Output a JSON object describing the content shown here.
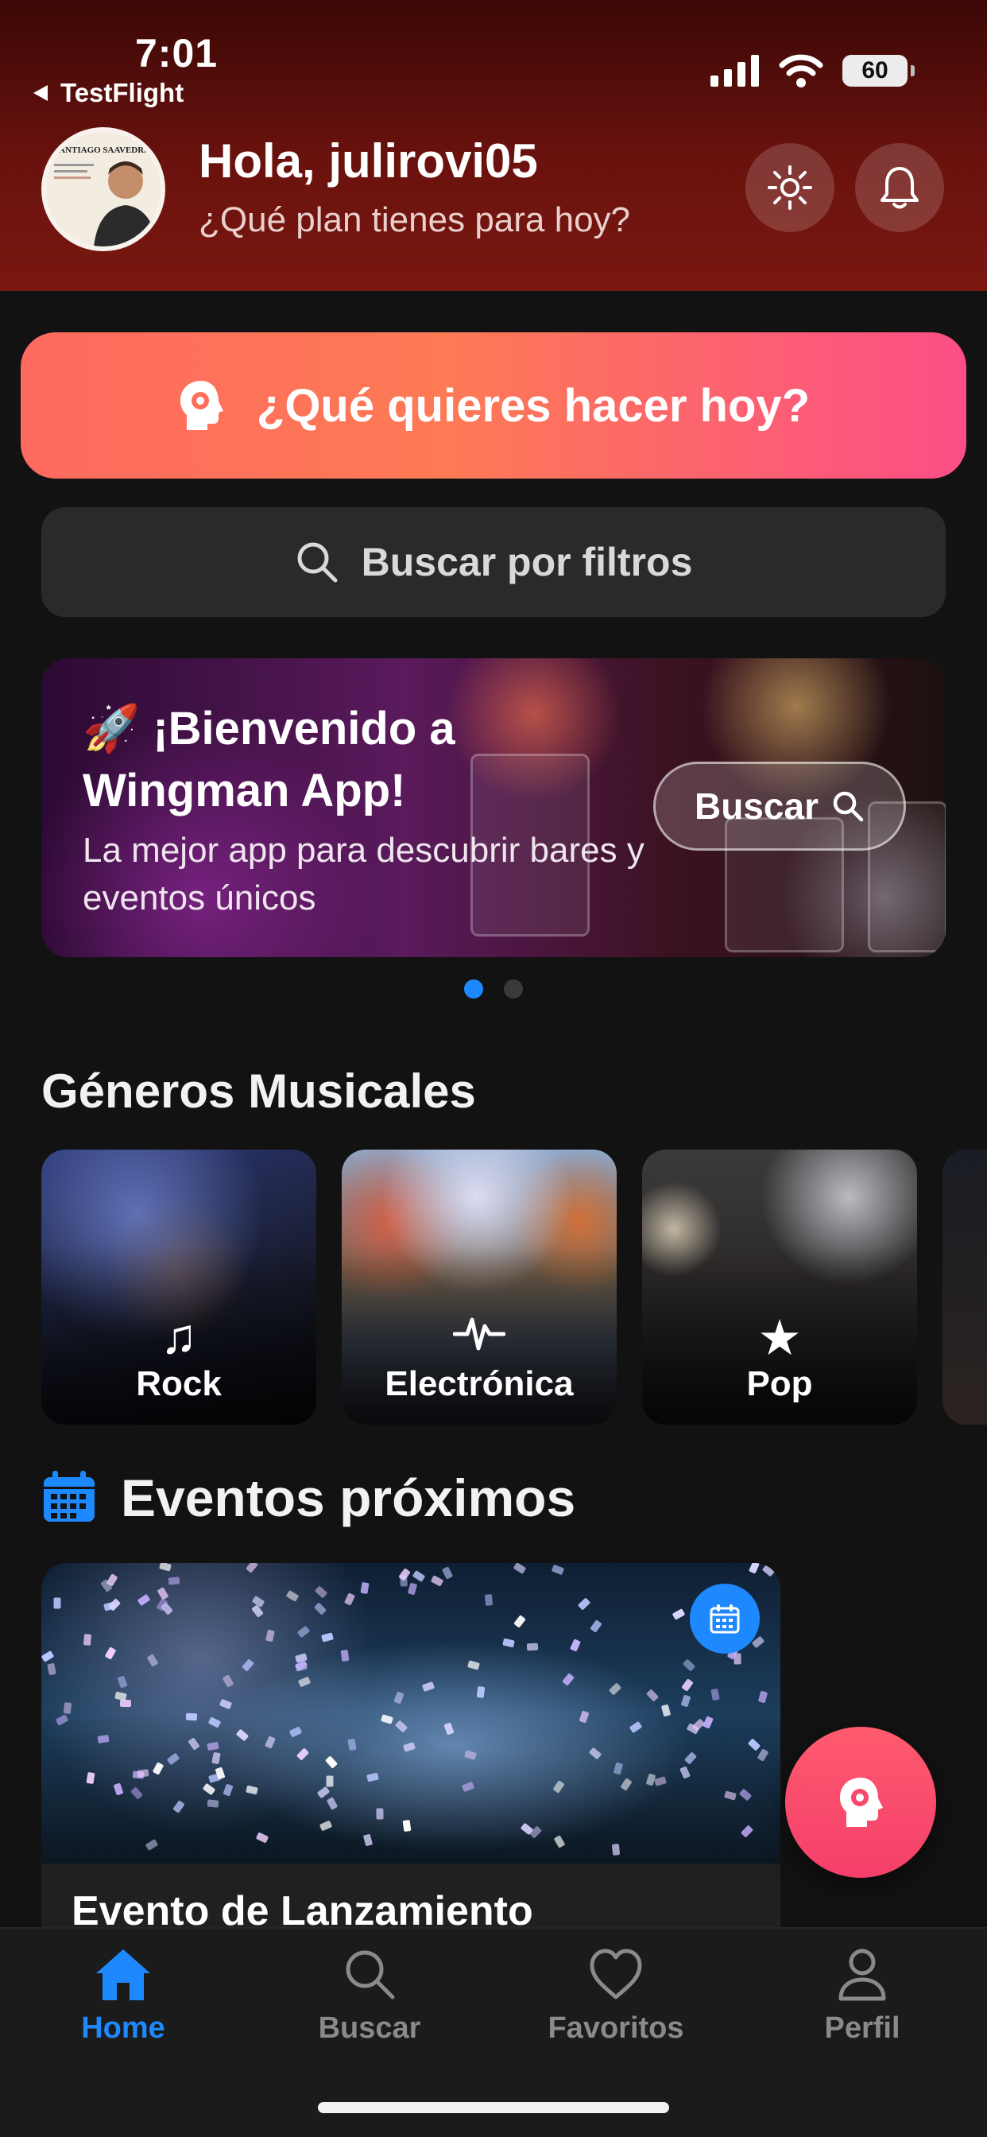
{
  "status_bar": {
    "time": "7:01",
    "back_app": "TestFlight",
    "battery": "60"
  },
  "header": {
    "greeting": "Hola, julirovi05",
    "subtitle": "¿Qué plan tienes para hoy?",
    "avatar_caption": "SANTIAGO SAAVEDRA"
  },
  "cta": {
    "label": "¿Qué quieres hacer hoy?"
  },
  "search": {
    "label": "Buscar por filtros"
  },
  "banner": {
    "emoji": "🚀",
    "title": "¡Bienvenido a Wingman App!",
    "text": "La mejor app para descubrir bares y eventos únicos",
    "button": "Buscar"
  },
  "carousel": {
    "pages": 2,
    "active": 0
  },
  "genres": {
    "title": "Géneros Musicales",
    "items": [
      {
        "label": "Rock",
        "icon": "music-note-icon"
      },
      {
        "label": "Electrónica",
        "icon": "pulse-icon"
      },
      {
        "label": "Pop",
        "icon": "star-icon"
      }
    ]
  },
  "events": {
    "title": "Eventos próximos",
    "items": [
      {
        "title": "Evento de Lanzamiento"
      }
    ]
  },
  "tabs": [
    {
      "label": "Home",
      "icon": "home-icon",
      "active": true
    },
    {
      "label": "Buscar",
      "icon": "search-icon",
      "active": false
    },
    {
      "label": "Favoritos",
      "icon": "heart-icon",
      "active": false
    },
    {
      "label": "Perfil",
      "icon": "person-icon",
      "active": false
    }
  ],
  "colors": {
    "accent": "#1e88ff",
    "cta_start": "#fe6a5f",
    "cta_end": "#fb4e86",
    "header": "#6a120e"
  }
}
